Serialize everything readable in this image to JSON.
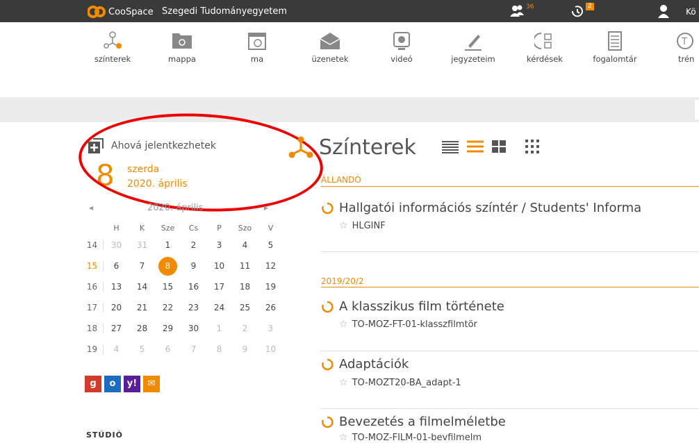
{
  "topbar": {
    "app_name": "CooSpace",
    "org_name": "Szegedi Tudományegyetem",
    "people_count": "36",
    "history_count": "2",
    "user_name_fragment": "Kö"
  },
  "toolbar": {
    "items": [
      {
        "label": "színterek",
        "icon": "network-icon"
      },
      {
        "label": "mappa",
        "icon": "folder-icon"
      },
      {
        "label": "ma",
        "icon": "calendar-today-icon"
      },
      {
        "label": "üzenetek",
        "icon": "envelope-icon"
      },
      {
        "label": "videó",
        "icon": "video-icon"
      },
      {
        "label": "jegyzeteim",
        "icon": "pen-icon"
      },
      {
        "label": "kérdések",
        "icon": "questions-icon"
      },
      {
        "label": "fogalomtár",
        "icon": "glossary-icon"
      },
      {
        "label": "trén",
        "icon": "training-icon"
      }
    ]
  },
  "sidebar": {
    "join_label": "Ahová jelentkezhetek",
    "date_number": "8",
    "date_weekday": "szerda",
    "date_full": "2020. április",
    "calendar": {
      "title": "2020. április",
      "prev": "◂",
      "next": "▸",
      "headers": [
        "H",
        "K",
        "Sze",
        "Cs",
        "P",
        "Szo",
        "V"
      ],
      "weeks": [
        {
          "wk": "14",
          "days": [
            "30",
            "31",
            "1",
            "2",
            "3",
            "4",
            "5"
          ]
        },
        {
          "wk": "15",
          "days": [
            "6",
            "7",
            "8",
            "9",
            "10",
            "11",
            "12"
          ]
        },
        {
          "wk": "16",
          "days": [
            "13",
            "14",
            "15",
            "16",
            "17",
            "18",
            "19"
          ]
        },
        {
          "wk": "17",
          "days": [
            "20",
            "21",
            "22",
            "23",
            "24",
            "25",
            "26"
          ]
        },
        {
          "wk": "18",
          "days": [
            "27",
            "28",
            "29",
            "30",
            "1",
            "2",
            "3"
          ]
        },
        {
          "wk": "19",
          "days": [
            "4",
            "5",
            "6",
            "7",
            "8",
            "9",
            "10"
          ]
        }
      ]
    },
    "ext": {
      "google": "g",
      "outlook": "o",
      "yahoo": "y!",
      "mail": "✉"
    },
    "study_fragment": "STÚDIÓ"
  },
  "main": {
    "title": "Színterek",
    "sections": [
      {
        "label": "ÁLLANDÓ"
      },
      {
        "label": "2019/20/2"
      }
    ],
    "items": [
      {
        "title": "Hallgatói információs színtér / Students' Informa",
        "code": "HLGINF"
      },
      {
        "title": "A klasszikus film története",
        "code": "TO-MOZ-FT-01-klasszfilmtör"
      },
      {
        "title": "Adaptációk",
        "code": "TO-MOZT20-BA_adapt-1"
      },
      {
        "title": "Bevezetés a filmelméletbe",
        "code": "TO-MOZ-FILM-01-bevfilmelm"
      }
    ]
  },
  "colors": {
    "accent": "#f08a00",
    "topbar": "#3a3a3a",
    "annotation": "#e00000"
  }
}
